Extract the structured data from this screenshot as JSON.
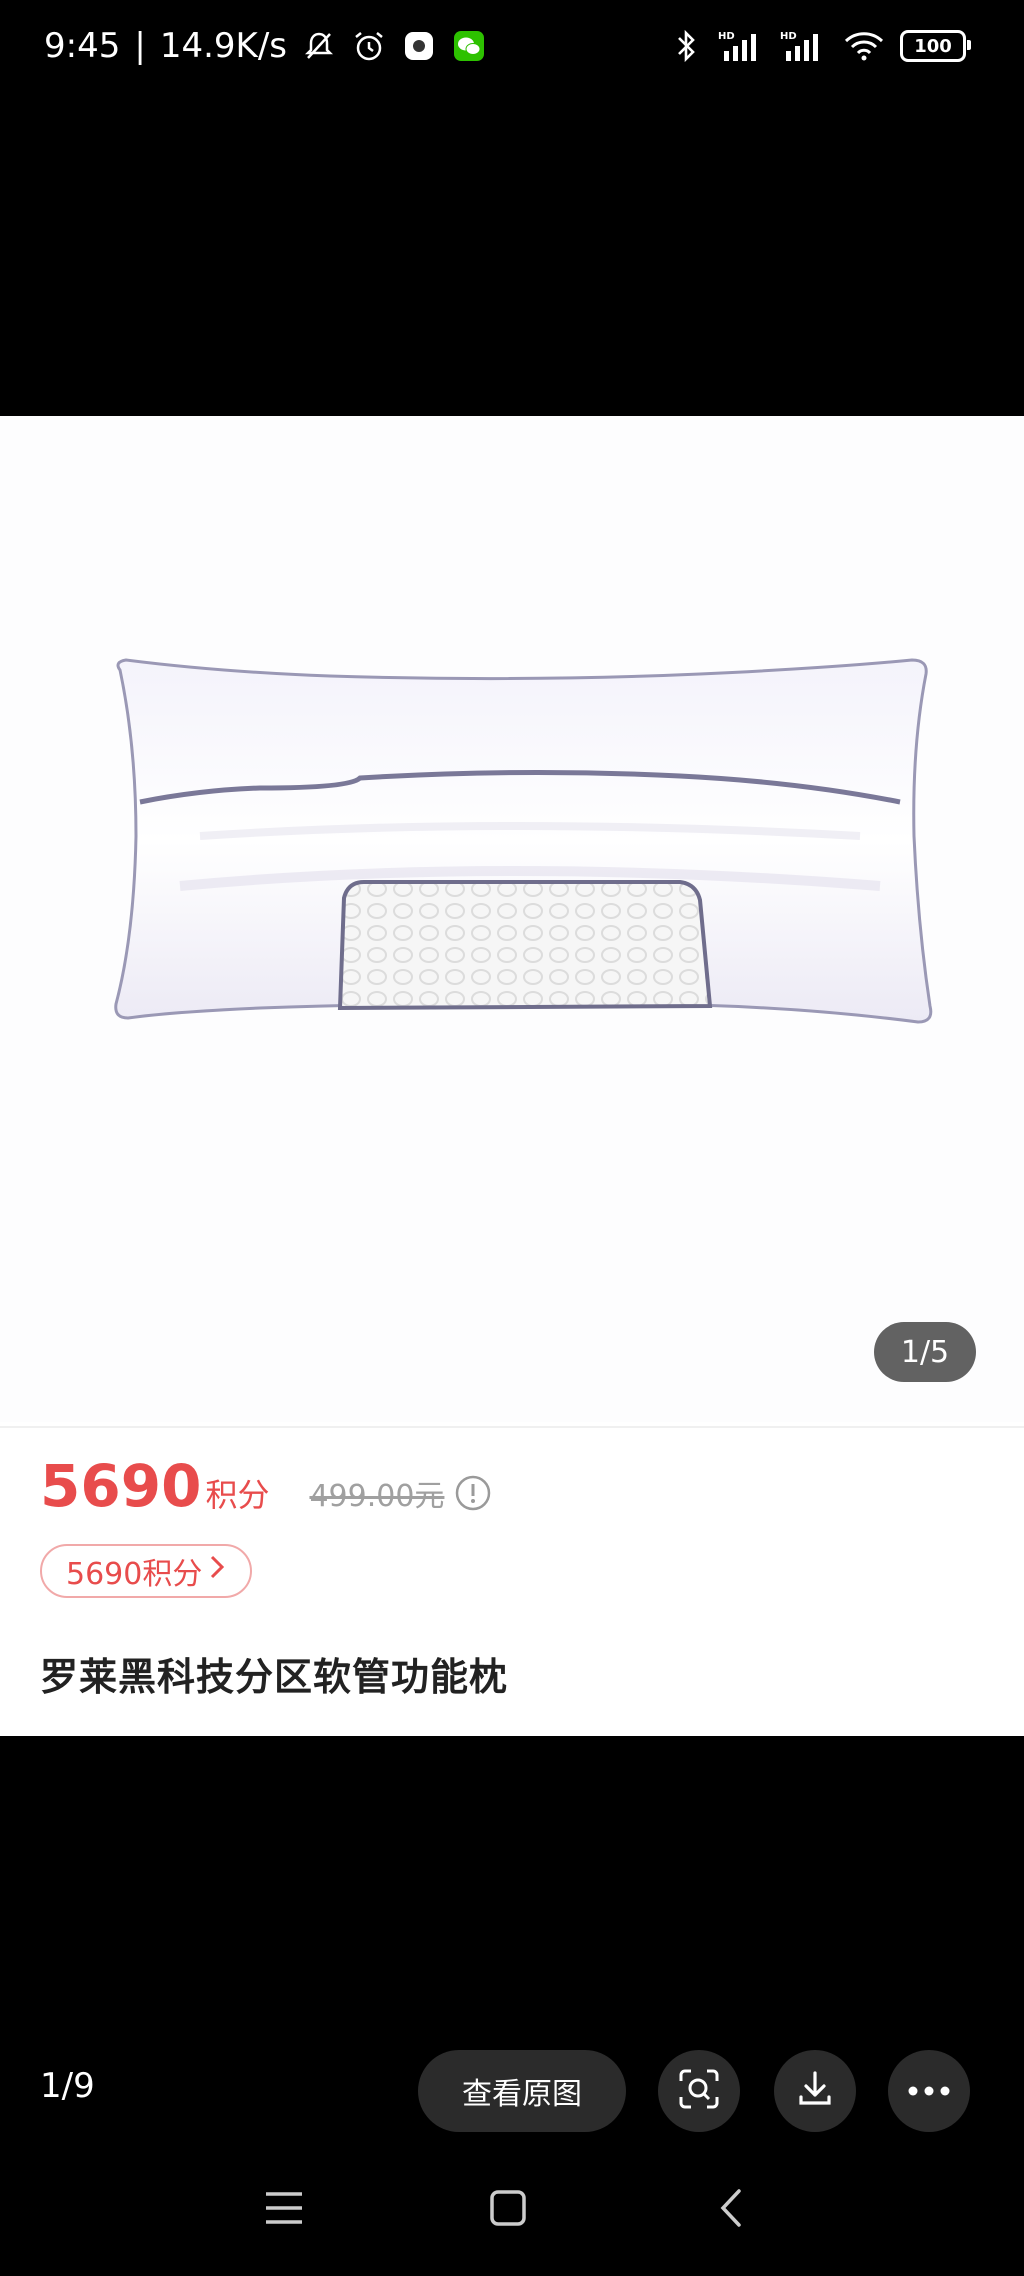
{
  "status_bar": {
    "time": "9:45",
    "separator": "|",
    "network_speed": "14.9K/s",
    "battery": "100",
    "icons_left": [
      "bell-off-icon",
      "alarm-icon",
      "app-icon",
      "wechat-icon"
    ],
    "icons_right": [
      "bluetooth-icon",
      "signal-hd-icon",
      "signal-hd-icon",
      "wifi-icon",
      "battery-icon"
    ]
  },
  "product": {
    "image_counter": "1/5",
    "price_points": "5690",
    "price_unit": "积分",
    "original_price": "499.00元",
    "points_pill_label": "5690积分",
    "title": "罗莱黑科技分区软管功能枕"
  },
  "viewer": {
    "counter": "1/9",
    "view_original_label": "查看原图"
  },
  "colors": {
    "price_red": "#e84c4c",
    "background": "#000000",
    "card": "#ffffff",
    "button_bg": "#2b2b2b"
  }
}
